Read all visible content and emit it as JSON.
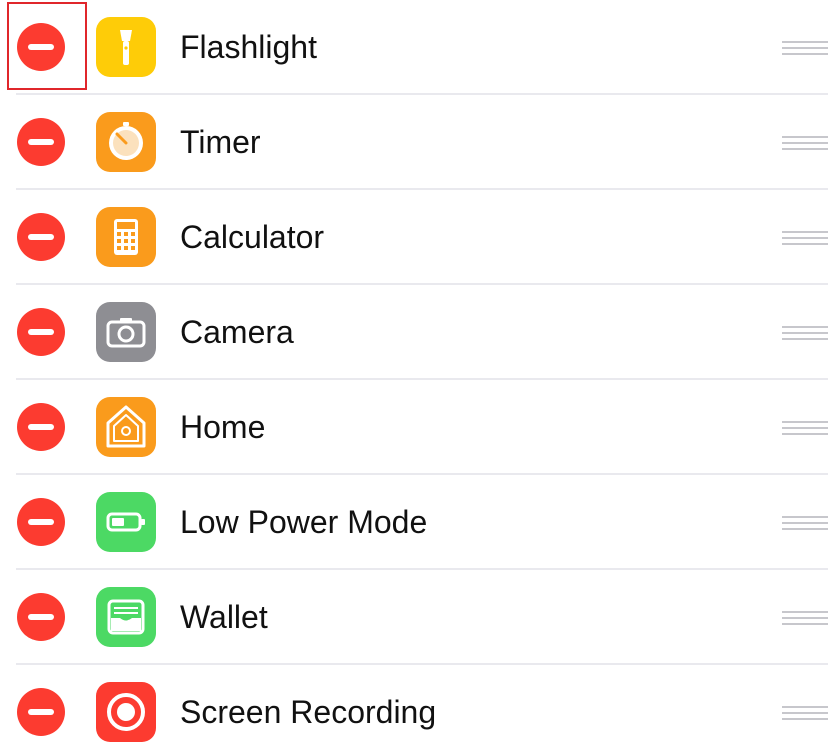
{
  "controls": [
    {
      "label": "Flashlight",
      "icon": "flashlight-icon",
      "color": "#fecc08"
    },
    {
      "label": "Timer",
      "icon": "timer-icon",
      "color": "#fa9b1c"
    },
    {
      "label": "Calculator",
      "icon": "calculator-icon",
      "color": "#fa9b1c"
    },
    {
      "label": "Camera",
      "icon": "camera-icon",
      "color": "#8e8e93"
    },
    {
      "label": "Home",
      "icon": "home-icon",
      "color": "#fa9b1c"
    },
    {
      "label": "Low Power Mode",
      "icon": "battery-icon",
      "color": "#4cd964"
    },
    {
      "label": "Wallet",
      "icon": "wallet-icon",
      "color": "#4cd964"
    },
    {
      "label": "Screen Recording",
      "icon": "screen-recording-icon",
      "color": "#fc3b30"
    }
  ],
  "colors": {
    "remove_button": "#fc3b30",
    "highlight_box": "#e0262b",
    "separator": "#e9e9ee",
    "grabber": "#c7c7cc"
  }
}
